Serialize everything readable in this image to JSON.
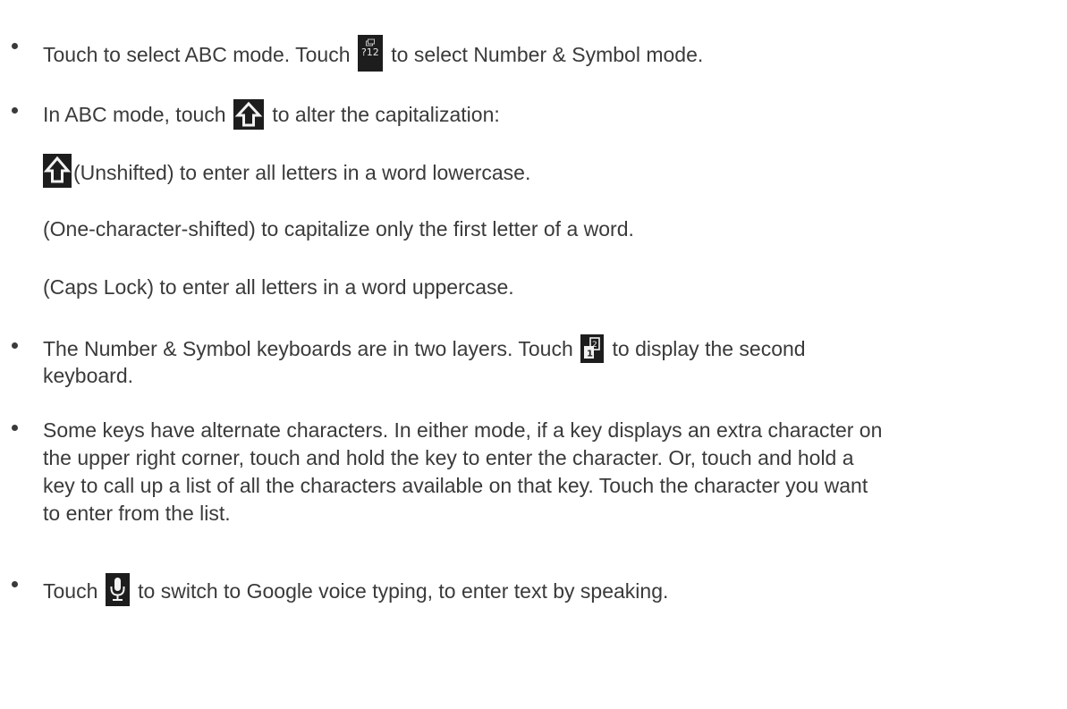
{
  "items": [
    {
      "before": "Touch to select ABC mode. Touch ",
      "icon": "number-symbol-key-icon",
      "icon_label": "?12",
      "after": " to select Number & Symbol mode."
    },
    {
      "before": "In ABC mode, touch ",
      "icon": "shift-key-icon",
      "after": " to alter the capitalization:"
    },
    {
      "before": "The Number & Symbol keyboards are in two layers. Touch ",
      "icon": "layer-switch-key-icon",
      "after": " to display the second",
      "continuation": "keyboard."
    },
    {
      "lines": [
        "Some keys have alternate characters. In either mode, if a key displays an extra character on",
        "the upper right corner, touch and hold the key to enter the character. Or, touch and hold a",
        "key to call up a list of all the characters available on that key. Touch the character you want",
        "to enter from the list."
      ]
    },
    {
      "before": "Touch ",
      "icon": "microphone-key-icon",
      "after": " to switch to Google voice typing, to enter text by speaking."
    }
  ],
  "capitalization": [
    {
      "icon": "shift-unshifted-icon",
      "text": "(Unshifted) to enter all letters in a word lowercase."
    },
    {
      "text": "(One-character-shifted) to capitalize only the first letter of a word."
    },
    {
      "text": "(Caps Lock) to enter all letters in a word uppercase."
    }
  ]
}
